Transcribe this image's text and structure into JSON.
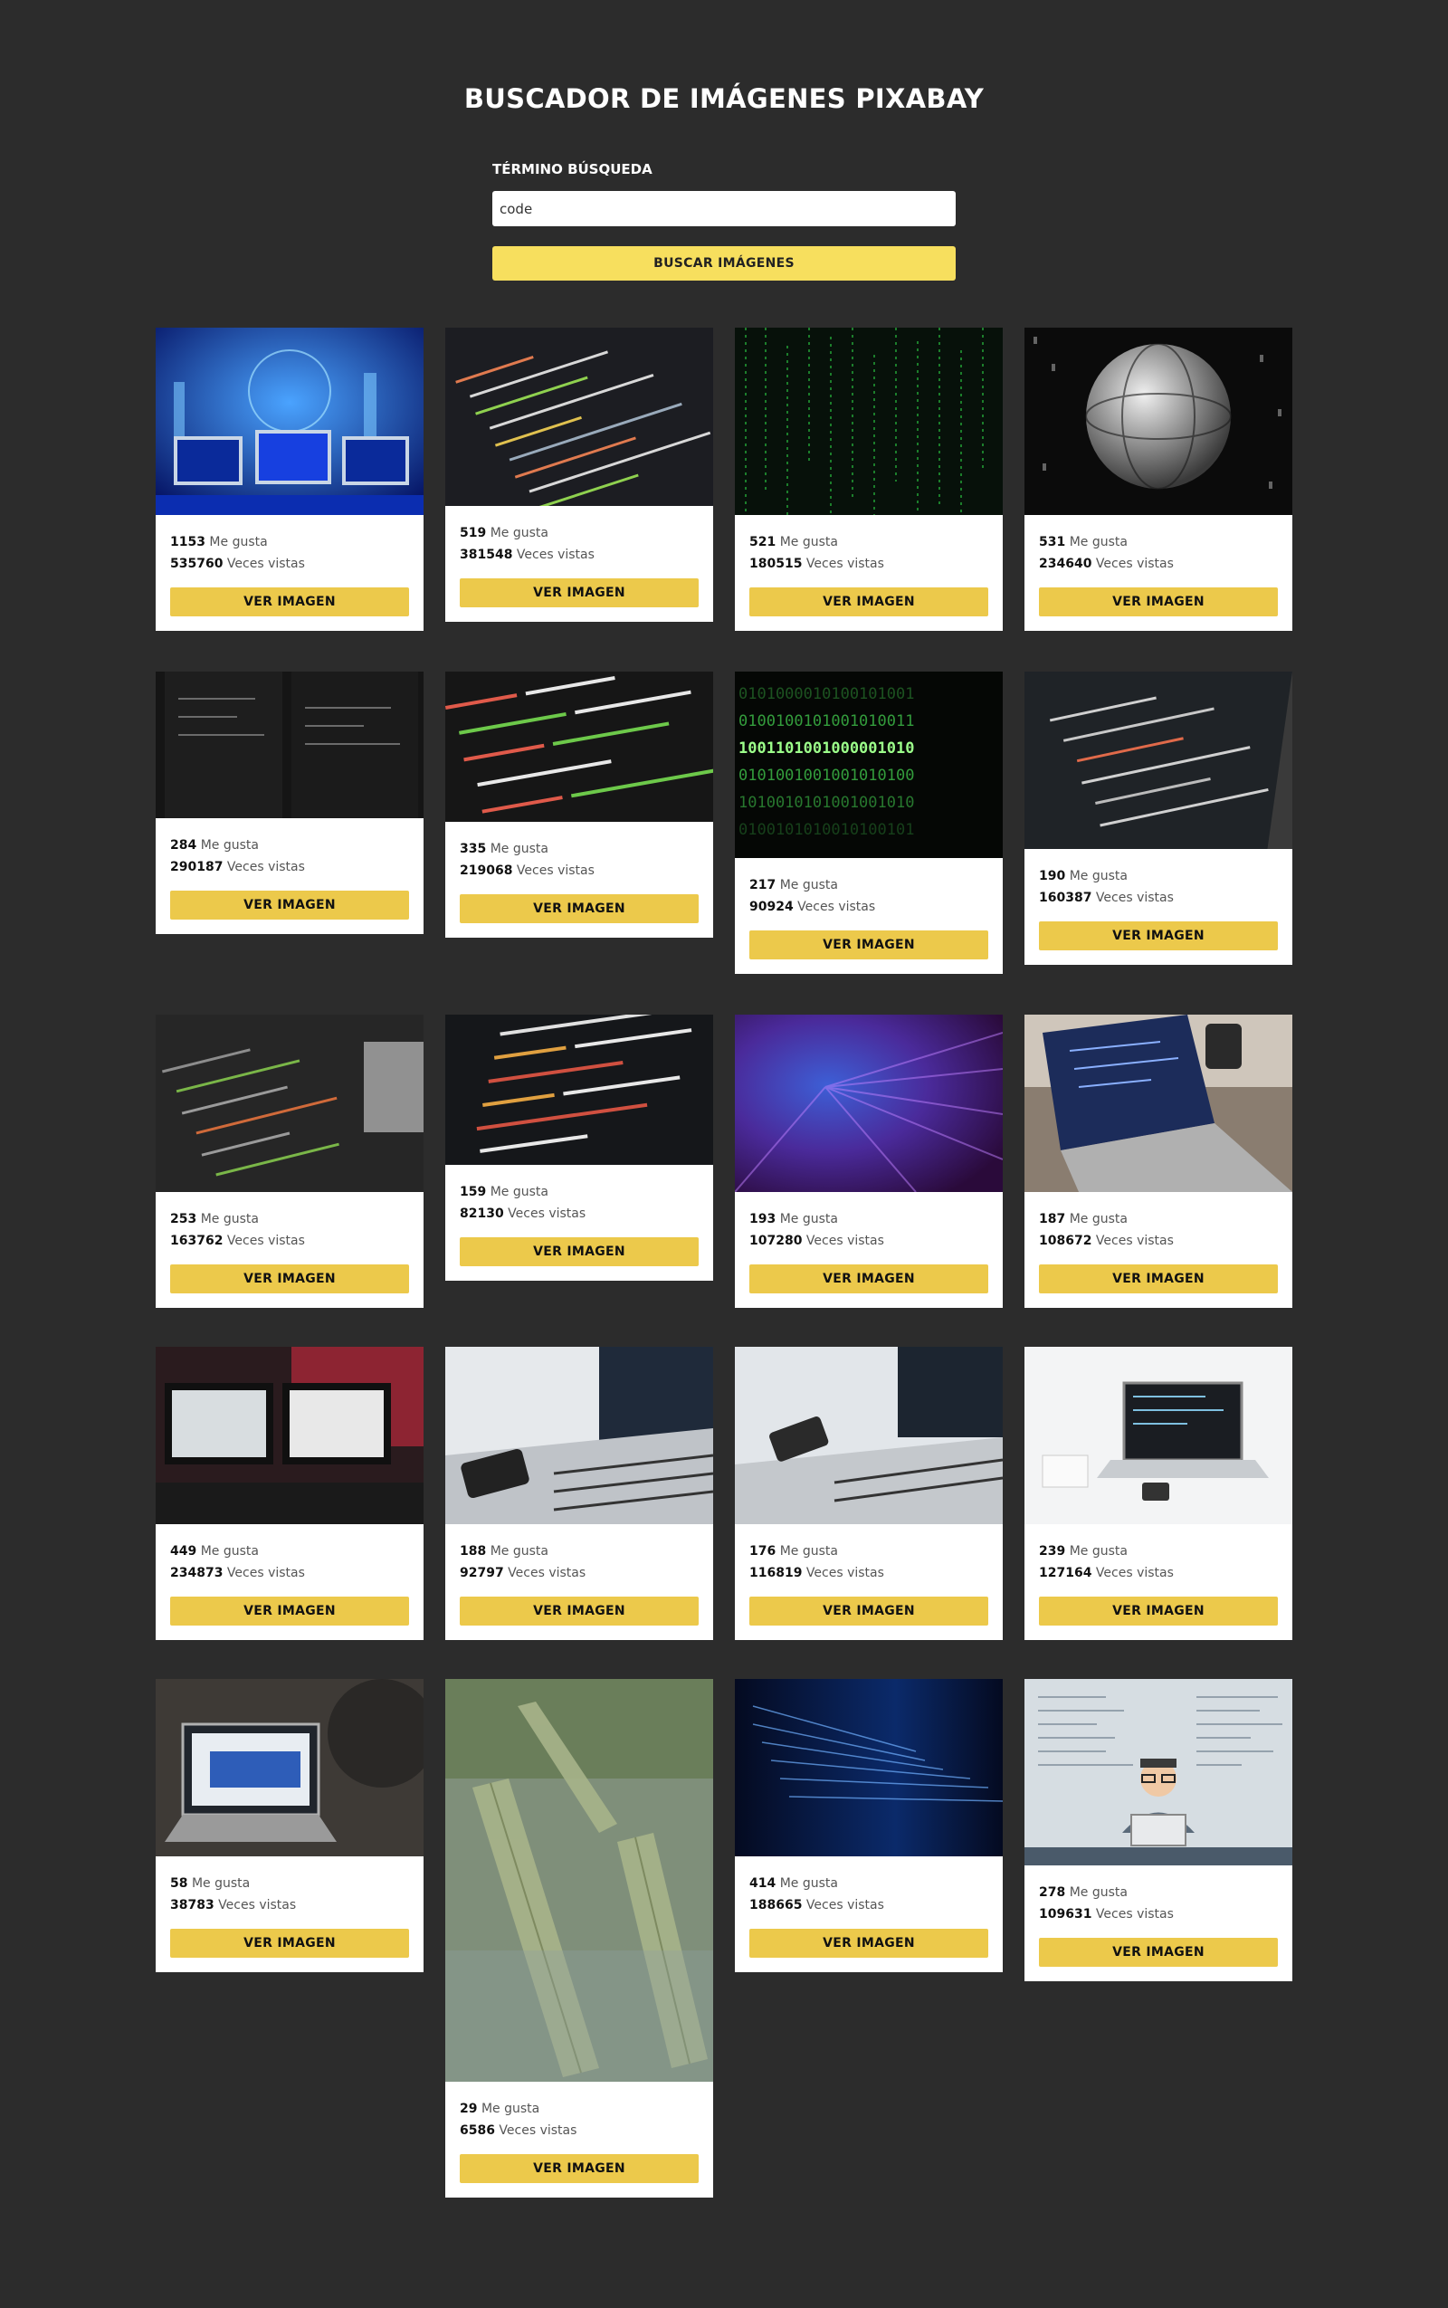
{
  "header": {
    "title": "BUSCADOR DE IMÁGENES PIXABAY"
  },
  "search": {
    "label": "TÉRMINO BÚSQUEDA",
    "value": "code",
    "button_label": "BUSCAR IMÁGENES"
  },
  "card_text": {
    "likes_label": "Me gusta",
    "views_label": "Veces vistas",
    "button_label": "VER IMAGEN"
  },
  "cards": [
    {
      "likes": "1153",
      "views": "535760",
      "image": "server-monitors-blue"
    },
    {
      "likes": "519",
      "views": "381548",
      "image": "code-screen-dark"
    },
    {
      "likes": "521",
      "views": "180515",
      "image": "matrix-green-rain"
    },
    {
      "likes": "531",
      "views": "234640",
      "image": "binary-sphere"
    },
    {
      "likes": "284",
      "views": "290187",
      "image": "code-editor-dark"
    },
    {
      "likes": "335",
      "views": "219068",
      "image": "code-colored-syntax"
    },
    {
      "likes": "217",
      "views": "90924",
      "image": "binary-green-digits"
    },
    {
      "likes": "190",
      "views": "160387",
      "image": "code-screen-angle"
    },
    {
      "likes": "253",
      "views": "163762",
      "image": "code-monitor-blur"
    },
    {
      "likes": "159",
      "views": "82130",
      "image": "code-css-syntax"
    },
    {
      "likes": "193",
      "views": "107280",
      "image": "purple-data-zoom"
    },
    {
      "likes": "187",
      "views": "108672",
      "image": "laptop-code-desk"
    },
    {
      "likes": "449",
      "views": "234873",
      "image": "dual-monitor-setup"
    },
    {
      "likes": "188",
      "views": "92797",
      "image": "laptop-phone-desk"
    },
    {
      "likes": "176",
      "views": "116819",
      "image": "laptop-code-white"
    },
    {
      "likes": "239",
      "views": "127164",
      "image": "laptop-bright-desk"
    },
    {
      "likes": "58",
      "views": "38783",
      "image": "person-laptop"
    },
    {
      "likes": "29",
      "views": "6586",
      "image": "river-bamboo-rafts"
    },
    {
      "likes": "414",
      "views": "188665",
      "image": "blue-data-stream"
    },
    {
      "likes": "278",
      "views": "109631",
      "image": "programmer-illustration"
    }
  ]
}
